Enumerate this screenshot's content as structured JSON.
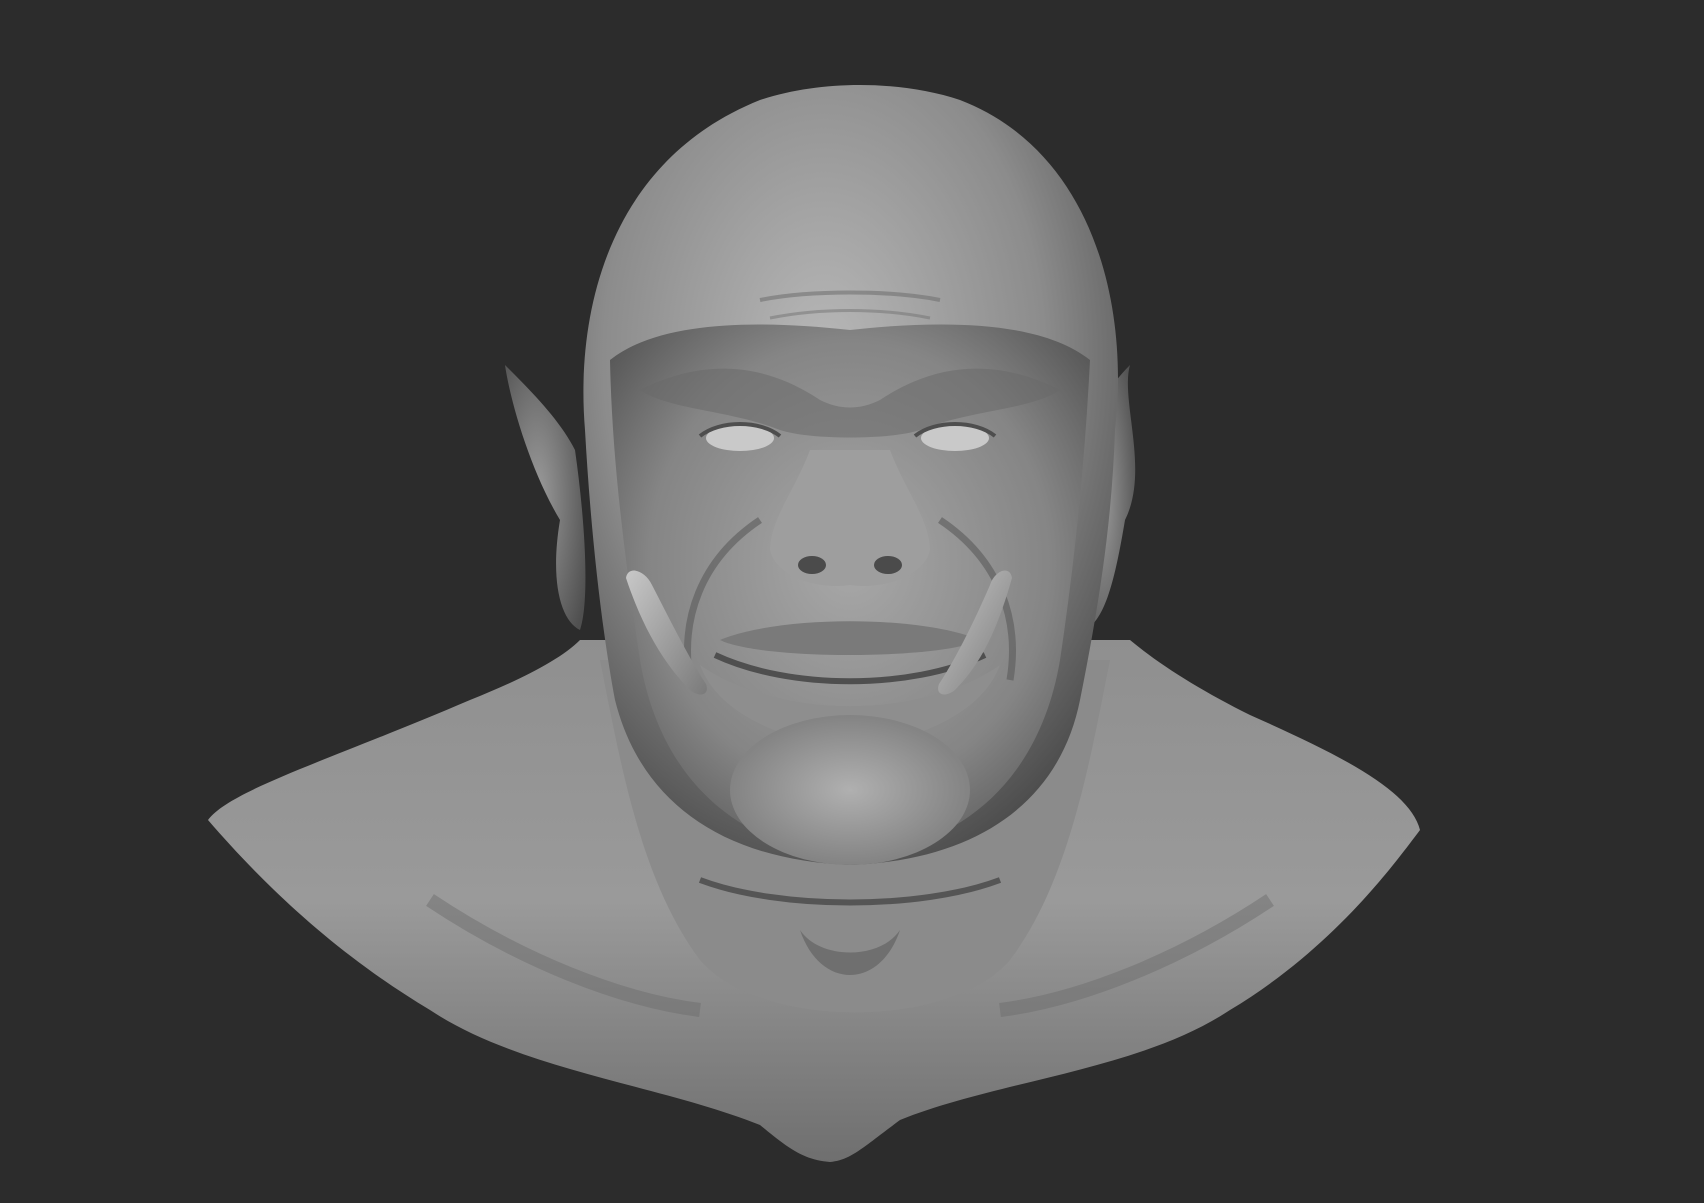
{
  "scene": {
    "subject": "sculpt-bust",
    "background_color": "#2c2c2c",
    "material_light": "#bdbdbd",
    "material_mid": "#8a8a8a",
    "material_dark": "#3a3a3a"
  }
}
